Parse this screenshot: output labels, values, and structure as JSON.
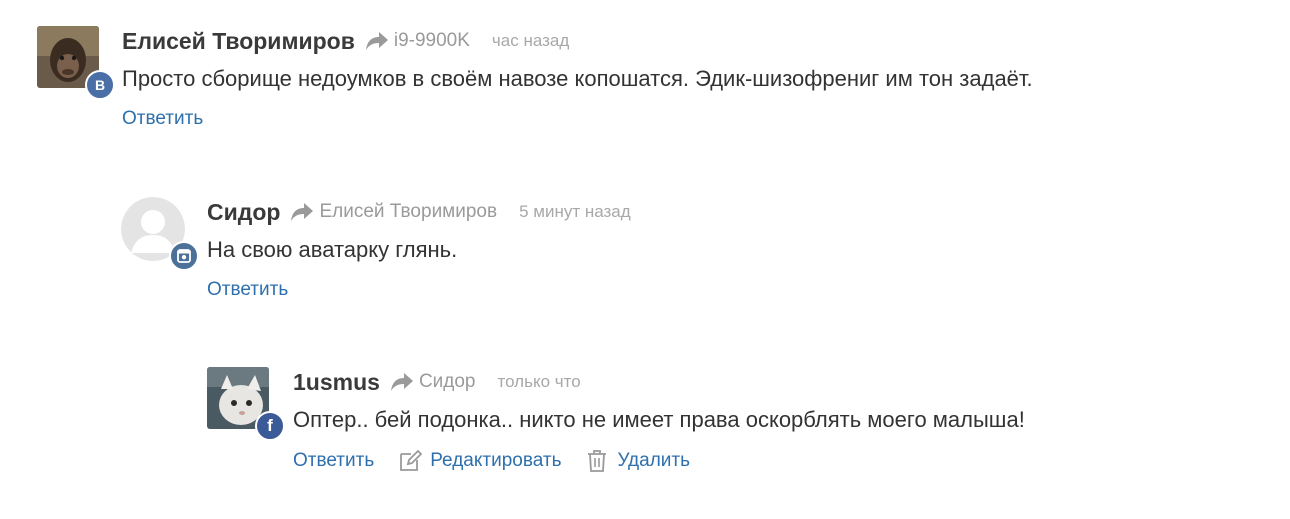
{
  "comments": [
    {
      "author": "Елисей Творимиров",
      "reply_to": "i9-9900K",
      "time": "час назад",
      "text": "Просто сборище недоумков в своём навозе копошатся. Эдик-шизофрениг им тон задаёт.",
      "network": "vk",
      "network_icon": "vk-icon",
      "badge_glyph": "B",
      "actions": {
        "reply": "Ответить"
      }
    },
    {
      "author": "Сидор",
      "reply_to": "Елисей Творимиров",
      "time": "5 минут назад",
      "text": "На свою аватарку глянь.",
      "network": "instagram",
      "network_icon": "instagram-icon",
      "actions": {
        "reply": "Ответить"
      }
    },
    {
      "author": "1usmus",
      "reply_to": "Сидор",
      "time": "только что",
      "text": "Оптер.. бей подонка.. никто не имеет права оскорблять моего малыша!",
      "network": "facebook",
      "network_icon": "facebook-icon",
      "badge_glyph": "f",
      "actions": {
        "reply": "Ответить",
        "edit": "Редактировать",
        "delete": "Удалить"
      }
    }
  ],
  "colors": {
    "link": "#2e6fad",
    "author": "#3a3a3a",
    "meta": "#9a9a9a",
    "vk": "#4a6ea6",
    "instagram": "#4b7199",
    "facebook": "#3b5a98"
  }
}
